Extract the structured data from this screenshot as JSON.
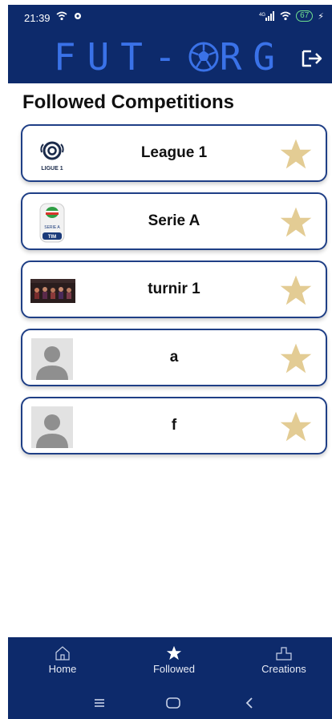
{
  "status_bar": {
    "time": "21:39",
    "left_icons": [
      "wifi-icon",
      "gear-icon"
    ],
    "right_icons": [
      "signal-4g-icon",
      "wifi-icon"
    ],
    "battery": "67"
  },
  "header": {
    "logo_text": "FUT-ORG",
    "logout_icon": "logout-icon",
    "colors": {
      "bar": "#0d2a6b",
      "logo": "#3a72e8"
    }
  },
  "page_title": "Followed Competitions",
  "competitions": [
    {
      "name": "League 1",
      "logo": "ligue-1-logo",
      "logo_caption": "LIGUE 1",
      "starred": true
    },
    {
      "name": "Serie A",
      "logo": "serie-a-logo",
      "logo_caption": "SERIE A",
      "logo_sub": "TIM",
      "starred": true
    },
    {
      "name": "turnir 1",
      "logo": "tournament-photo",
      "starred": true
    },
    {
      "name": "a",
      "logo": "default-avatar",
      "starred": true
    },
    {
      "name": "f",
      "logo": "default-avatar",
      "starred": true
    }
  ],
  "star_color": "#e3cc94",
  "bottom_nav": {
    "items": [
      {
        "label": "Home",
        "icon": "home-icon"
      },
      {
        "label": "Followed",
        "icon": "star-icon",
        "active": true
      },
      {
        "label": "Creations",
        "icon": "creations-icon"
      }
    ]
  },
  "system_nav": [
    "menu-icon",
    "home-button-icon",
    "back-icon"
  ]
}
